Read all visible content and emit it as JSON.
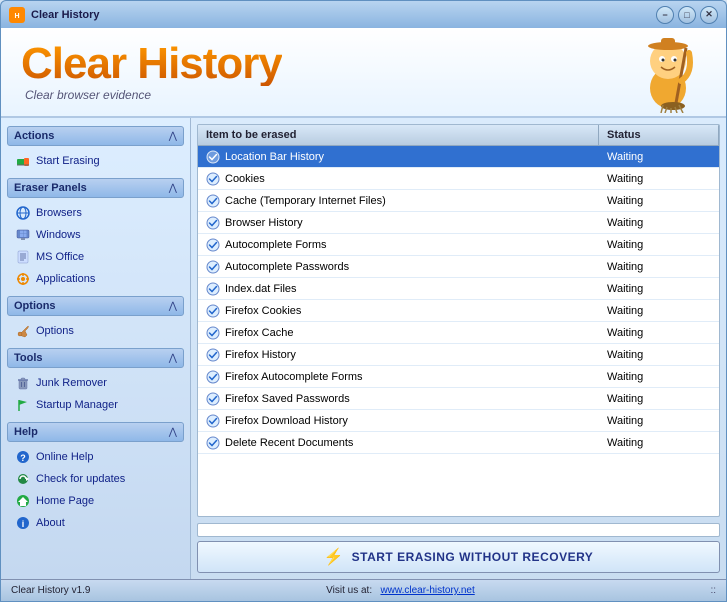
{
  "titleBar": {
    "title": "Clear History",
    "minButton": "−",
    "maxButton": "□",
    "closeButton": "✕"
  },
  "header": {
    "logoTitle": "Clear History",
    "logoSubtitle": "Clear browser evidence"
  },
  "sidebar": {
    "sections": [
      {
        "id": "actions",
        "header": "Actions",
        "items": [
          {
            "id": "start-erasing",
            "label": "Start Erasing",
            "icon": "eraser"
          }
        ]
      },
      {
        "id": "eraser-panels",
        "header": "Eraser Panels",
        "items": [
          {
            "id": "browsers",
            "label": "Browsers",
            "icon": "globe"
          },
          {
            "id": "windows",
            "label": "Windows",
            "icon": "monitor"
          },
          {
            "id": "ms-office",
            "label": "MS Office",
            "icon": "document"
          },
          {
            "id": "applications",
            "label": "Applications",
            "icon": "gear"
          }
        ]
      },
      {
        "id": "options",
        "header": "Options",
        "items": [
          {
            "id": "options",
            "label": "Options",
            "icon": "wrench"
          }
        ]
      },
      {
        "id": "tools",
        "header": "Tools",
        "items": [
          {
            "id": "junk-remover",
            "label": "Junk Remover",
            "icon": "trash"
          },
          {
            "id": "startup-manager",
            "label": "Startup Manager",
            "icon": "flag"
          }
        ]
      },
      {
        "id": "help",
        "header": "Help",
        "items": [
          {
            "id": "online-help",
            "label": "Online Help",
            "icon": "question"
          },
          {
            "id": "check-updates",
            "label": "Check for updates",
            "icon": "refresh"
          },
          {
            "id": "home-page",
            "label": "Home Page",
            "icon": "home"
          },
          {
            "id": "about",
            "label": "About",
            "icon": "info"
          }
        ]
      }
    ]
  },
  "table": {
    "columns": [
      {
        "id": "item",
        "label": "Item to be erased"
      },
      {
        "id": "status",
        "label": "Status"
      }
    ],
    "rows": [
      {
        "id": 1,
        "item": "Location Bar History",
        "status": "Waiting",
        "selected": true
      },
      {
        "id": 2,
        "item": "Cookies",
        "status": "Waiting",
        "selected": false
      },
      {
        "id": 3,
        "item": "Cache (Temporary Internet Files)",
        "status": "Waiting",
        "selected": false
      },
      {
        "id": 4,
        "item": "Browser History",
        "status": "Waiting",
        "selected": false
      },
      {
        "id": 5,
        "item": "Autocomplete Forms",
        "status": "Waiting",
        "selected": false
      },
      {
        "id": 6,
        "item": "Autocomplete Passwords",
        "status": "Waiting",
        "selected": false
      },
      {
        "id": 7,
        "item": "Index.dat Files",
        "status": "Waiting",
        "selected": false
      },
      {
        "id": 8,
        "item": "Firefox Cookies",
        "status": "Waiting",
        "selected": false
      },
      {
        "id": 9,
        "item": "Firefox Cache",
        "status": "Waiting",
        "selected": false
      },
      {
        "id": 10,
        "item": "Firefox History",
        "status": "Waiting",
        "selected": false
      },
      {
        "id": 11,
        "item": "Firefox Autocomplete Forms",
        "status": "Waiting",
        "selected": false
      },
      {
        "id": 12,
        "item": "Firefox Saved Passwords",
        "status": "Waiting",
        "selected": false
      },
      {
        "id": 13,
        "item": "Firefox Download History",
        "status": "Waiting",
        "selected": false
      },
      {
        "id": 14,
        "item": "Delete Recent Documents",
        "status": "Waiting",
        "selected": false
      }
    ]
  },
  "eraseButton": {
    "label": "START ERASING WITHOUT RECOVERY"
  },
  "statusBar": {
    "version": "Clear History v1.9",
    "visitLabel": "Visit us at:",
    "website": "www.clear-history.net"
  }
}
